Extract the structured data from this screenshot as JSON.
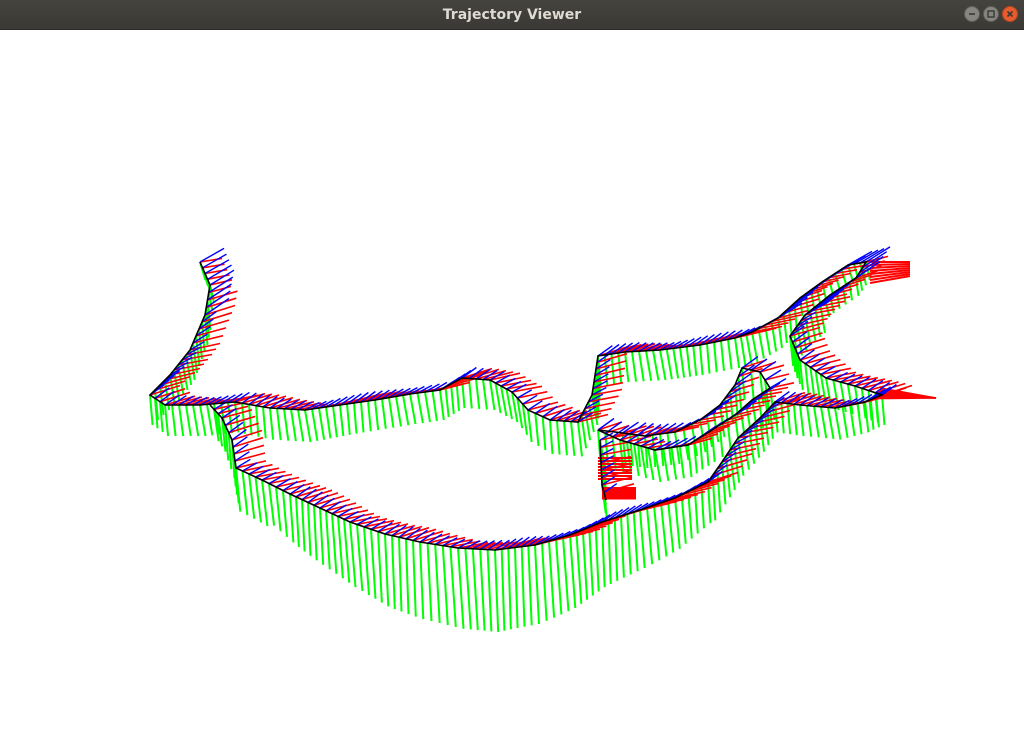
{
  "window": {
    "title": "Trajectory Viewer",
    "controls": [
      "minimize-icon",
      "maximize-icon",
      "close-icon"
    ]
  },
  "viewer": {
    "background": "#ffffff",
    "axis_colors": {
      "x_axis": "#ff0000",
      "y_axis": "#00ff00",
      "z_axis": "#0000ff"
    },
    "trajectory_color": "#000000"
  }
}
